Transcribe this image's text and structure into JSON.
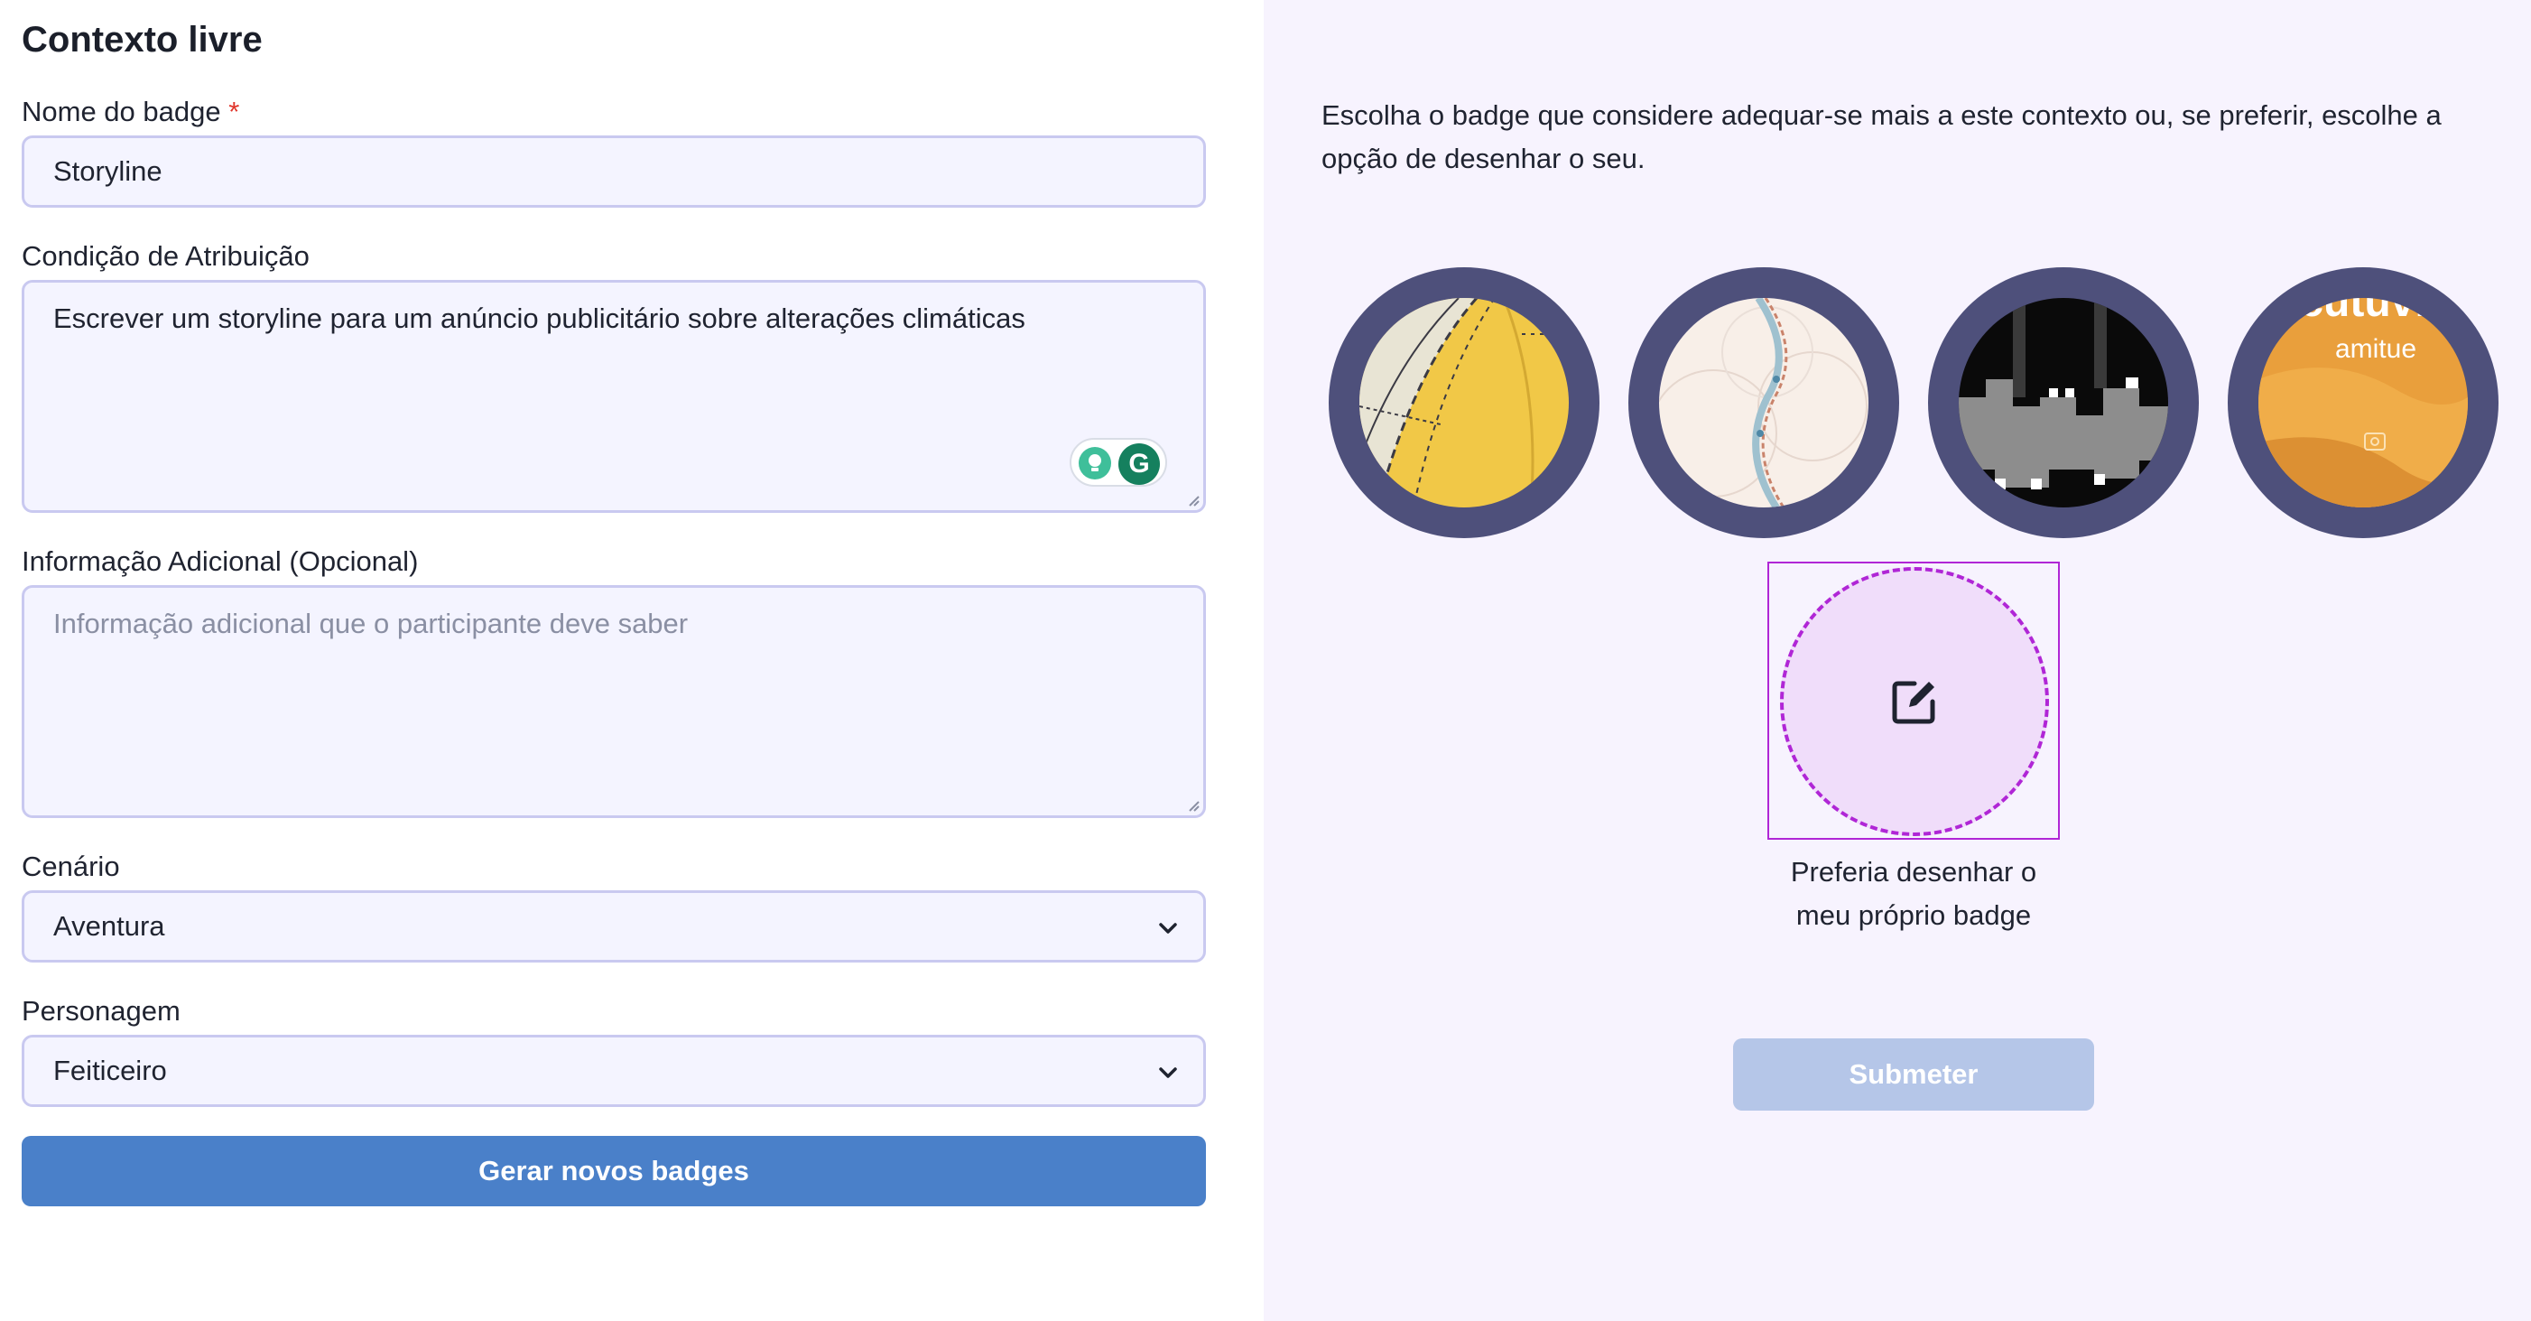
{
  "form": {
    "title": "Contexto livre",
    "badge_name_label": "Nome do badge",
    "required_marker": "*",
    "badge_name_value": "Storyline",
    "condition_label": "Condição de Atribuição",
    "condition_value": "Escrever um storyline para um anúncio publicitário sobre alterações climáticas",
    "extra_label": "Informação Adicional (Opcional)",
    "extra_placeholder": "Informação adicional que o participante deve saber",
    "scenario_label": "Cenário",
    "scenario_value": "Aventura",
    "character_label": "Personagem",
    "character_value": "Feiticeiro",
    "generate_button": "Gerar novos badges"
  },
  "grammarly": {
    "letter": "G"
  },
  "selector": {
    "intro": "Escolha o badge que considere adequar-se mais a este contexto ou, se preferir, escolhe a opção de desenhar o seu.",
    "badges": [
      {
        "name": "badge-option-yellow-map"
      },
      {
        "name": "badge-option-route-map"
      },
      {
        "name": "badge-option-pixel-city"
      },
      {
        "name": "badge-option-orange-desert",
        "text_large": "cutuvi",
        "text_small": "amitue"
      }
    ],
    "draw_caption_line1": "Preferia desenhar o",
    "draw_caption_line2": "meu próprio badge",
    "submit_button": "Submeter"
  },
  "colors": {
    "primary_button": "#4a80c9",
    "disabled_button": "#b5c6e8",
    "badge_ring": "#4e507b",
    "draw_accent": "#b026d6",
    "right_panel_bg": "#f7f3fe",
    "field_bg": "#f4f4ff",
    "field_border": "#c9c9f0",
    "required": "#e0362c"
  }
}
